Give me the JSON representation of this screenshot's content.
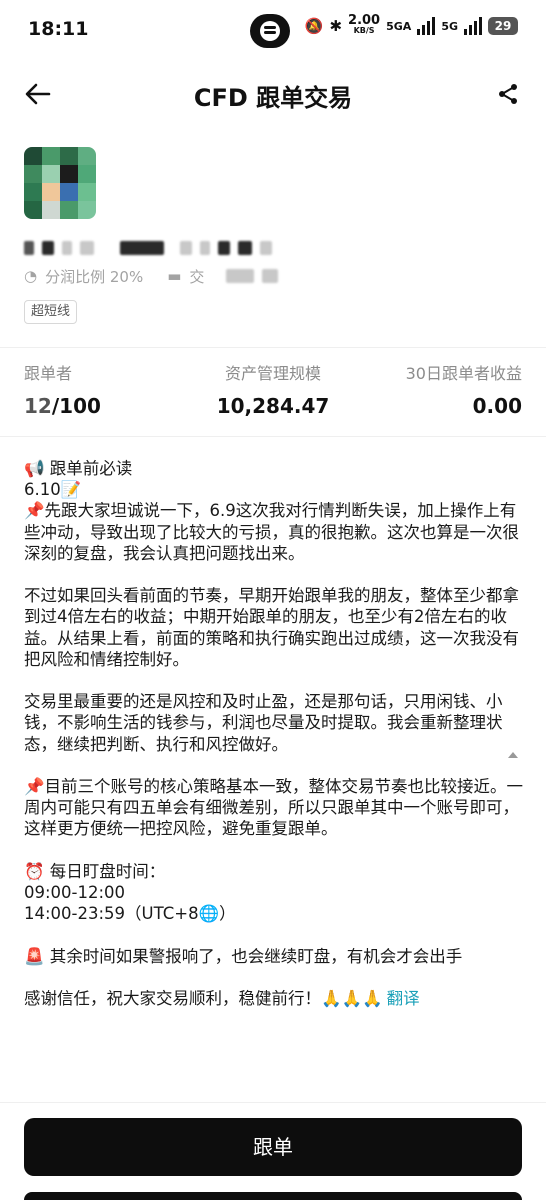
{
  "status_bar": {
    "time": "18:11",
    "net_speed": "2.00",
    "net_unit": "KB/S",
    "sig1": "5GA",
    "sig2": "5G",
    "battery": "29"
  },
  "header": {
    "title": "CFD 跟单交易",
    "back_icon": "arrow-left-icon",
    "share_icon": "share-icon"
  },
  "profile": {
    "share_ratio_label": "分润比例 20%",
    "exchange_label": "交",
    "tag": "超短线"
  },
  "stats": {
    "followers_label": "跟单者",
    "followers_value": "12",
    "followers_max": "/100",
    "aum_label": "资产管理规模",
    "aum_value": "10,284.47",
    "profit_label": "30日跟单者收益",
    "profit_value": "0.00"
  },
  "intro": {
    "heading": "📢 跟单前必读",
    "date": "6.10📝",
    "para1": "📌先跟大家坦诚说一下，6.9这次我对行情判断失误，加上操作上有些冲动，导致出现了比较大的亏损，真的很抱歉。这次也算是一次很深刻的复盘，我会认真把问题找出来。",
    "para2": "不过如果回头看前面的节奏，早期开始跟单我的朋友，整体至少都拿到过4倍左右的收益；中期开始跟单的朋友，也至少有2倍左右的收益。从结果上看，前面的策略和执行确实跑出过成绩，这一次我没有把风险和情绪控制好。",
    "para3": "交易里最重要的还是风控和及时止盈，还是那句话，只用闲钱、小钱，不影响生活的钱参与，利润也尽量及时提取。我会重新整理状态，继续把判断、执行和风控做好。",
    "para4": "📌目前三个账号的核心策略基本一致，整体交易节奏也比较接近。一周内可能只有四五单会有细微差别，所以只跟单其中一个账号即可，这样更方便统一把控风险，避免重复跟单。",
    "schedule_title": "⏰ 每日盯盘时间：",
    "schedule_1": "09:00-12:00",
    "schedule_2": "14:00-23:59（UTC+8🌐）",
    "alert": "🚨 其余时间如果警报响了，也会继续盯盘，有机会才会出手",
    "thanks": "感谢信任，祝大家交易顺利，稳健前行！🙏🙏🙏",
    "translate": "翻译"
  },
  "actions": {
    "follow_button": "跟单"
  }
}
